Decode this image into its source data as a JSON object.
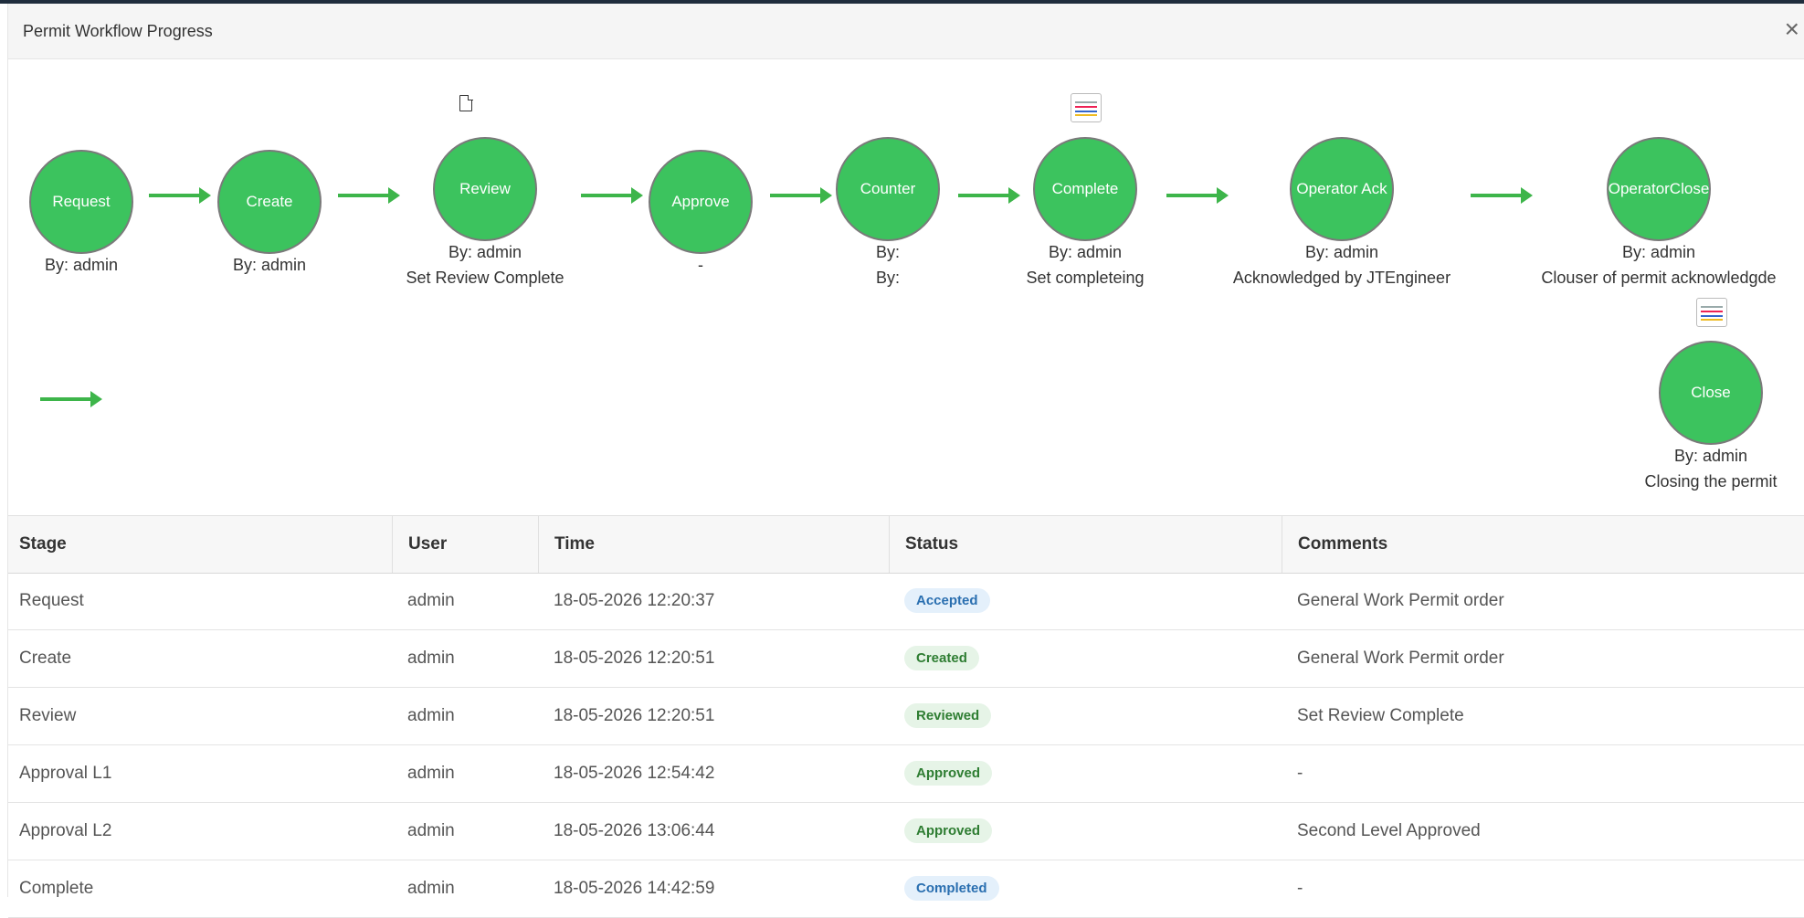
{
  "modal": {
    "title": "Permit Workflow Progress",
    "close_glyph": "×"
  },
  "colors": {
    "node_fill": "#3cc35e",
    "arrow": "#3db54a",
    "accepted": "#2a6fb0",
    "accepted_bg": "#e4f0fb",
    "approved": "#2e7d32",
    "approved_bg": "#e6f4e7"
  },
  "workflow": {
    "nodes": [
      {
        "label": "Request",
        "lines": [
          "By: admin"
        ]
      },
      {
        "label": "Create",
        "lines": [
          "By: admin"
        ]
      },
      {
        "label": "Review",
        "lines": [
          "By: admin",
          "Set Review Complete"
        ],
        "icon": "document-icon"
      },
      {
        "label": "Approve",
        "lines": [
          "-"
        ]
      },
      {
        "label": "Counter",
        "lines": [
          "By:",
          "By:"
        ]
      },
      {
        "label": "Complete",
        "lines": [
          "By: admin",
          "Set completeing"
        ],
        "icon": "signature-icon"
      },
      {
        "label": "Operator Ack",
        "lines": [
          "By: admin",
          "Acknowledged by JTEngineer"
        ]
      },
      {
        "label": "OperatorClose",
        "lines": [
          "By: admin",
          "Clouser of permit acknowledgde"
        ]
      },
      {
        "label": "Close",
        "lines": [
          "By: admin",
          "Closing the permit"
        ],
        "icon": "signature-icon"
      }
    ]
  },
  "table": {
    "columns": [
      "Stage",
      "User",
      "Time",
      "Status",
      "Comments"
    ],
    "rows": [
      {
        "stage": "Request",
        "user": "admin",
        "time": "18-05-2026 12:20:37",
        "status": "Accepted",
        "comments": "General Work Permit order"
      },
      {
        "stage": "Create",
        "user": "admin",
        "time": "18-05-2026 12:20:51",
        "status": "Created",
        "comments": "General Work Permit order"
      },
      {
        "stage": "Review",
        "user": "admin",
        "time": "18-05-2026 12:20:51",
        "status": "Reviewed",
        "comments": "Set Review Complete"
      },
      {
        "stage": "Approval L1",
        "user": "admin",
        "time": "18-05-2026 12:54:42",
        "status": "Approved",
        "comments": "-"
      },
      {
        "stage": "Approval L2",
        "user": "admin",
        "time": "18-05-2026 13:06:44",
        "status": "Approved",
        "comments": "Second Level Approved"
      },
      {
        "stage": "Complete",
        "user": "admin",
        "time": "18-05-2026 14:42:59",
        "status": "Completed",
        "comments": "-"
      }
    ]
  }
}
